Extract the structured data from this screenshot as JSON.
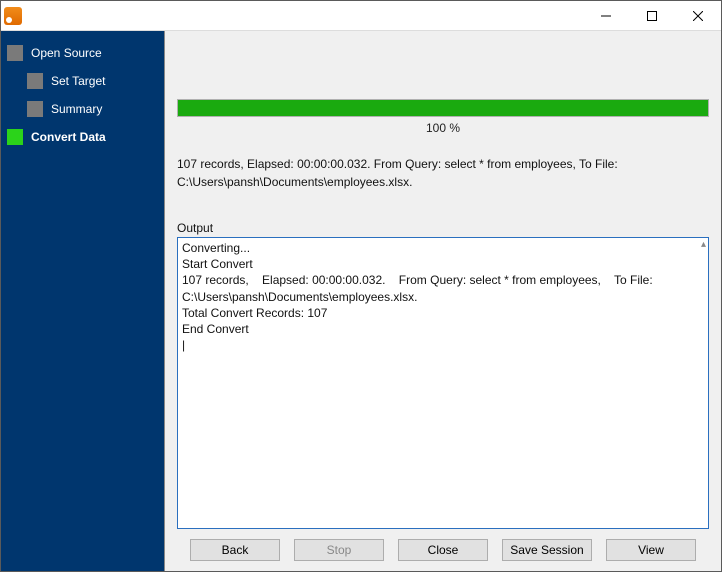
{
  "window": {
    "title": ""
  },
  "sidebar": {
    "items": [
      {
        "label": "Open Source"
      },
      {
        "label": "Set Target"
      },
      {
        "label": "Summary"
      },
      {
        "label": "Convert Data"
      }
    ]
  },
  "progress": {
    "percent_label": "100 %",
    "fill_color": "#1aaa0f"
  },
  "summary": {
    "line1": "107 records,    Elapsed: 00:00:00.032.    From Query: select * from employees,    To File:",
    "line2": "C:\\Users\\pansh\\Documents\\employees.xlsx."
  },
  "output": {
    "label": "Output",
    "text": "Converting...\nStart Convert\n107 records,    Elapsed: 00:00:00.032.    From Query: select * from employees,    To File: C:\\Users\\pansh\\Documents\\employees.xlsx.\nTotal Convert Records: 107\nEnd Convert\n|"
  },
  "buttons": {
    "back": "Back",
    "stop": "Stop",
    "close": "Close",
    "save_session": "Save Session",
    "view": "View"
  }
}
